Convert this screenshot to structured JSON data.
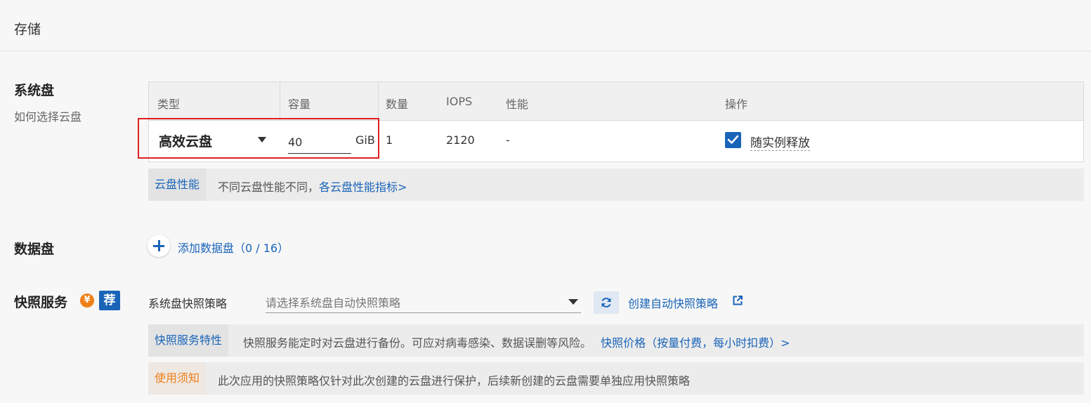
{
  "section": {
    "title": "存储"
  },
  "system_disk": {
    "title": "系统盘",
    "help_link": "如何选择云盘",
    "columns": [
      "类型",
      "容量",
      "数量",
      "IOPS",
      "性能",
      "操作"
    ],
    "row": {
      "type": "高效云盘",
      "capacity": "40",
      "unit": "GiB",
      "quantity": "1",
      "iops": "2120",
      "performance": "-",
      "release_checked": true,
      "release_label": "随实例释放"
    },
    "info": {
      "tag": "云盘性能",
      "text": "不同云盘性能不同，",
      "link": "各云盘性能指标>"
    }
  },
  "data_disk": {
    "title": "数据盘",
    "add_label": "添加数据盘（0 / 16）"
  },
  "snapshot": {
    "title": "快照服务",
    "yen_icon": "¥",
    "recommend_badge": "荐",
    "policy_label": "系统盘快照策略",
    "policy_placeholder": "请选择系统盘自动快照策略",
    "create_link": "创建自动快照策略",
    "feature": {
      "tag": "快照服务特性",
      "text": "快照服务能定时对云盘进行备份。可应对病毒感染、数据误删等风险。",
      "link": "快照价格（按量付费，每小时扣费）>"
    },
    "notice": {
      "tag": "使用须知",
      "text": "此次应用的快照策略仅针对此次创建的云盘进行保护，后续新创建的云盘需要单独应用快照策略"
    }
  },
  "colors": {
    "accent": "#1a64b8",
    "warning": "#f0801a",
    "highlight_box": "#e0201f"
  }
}
